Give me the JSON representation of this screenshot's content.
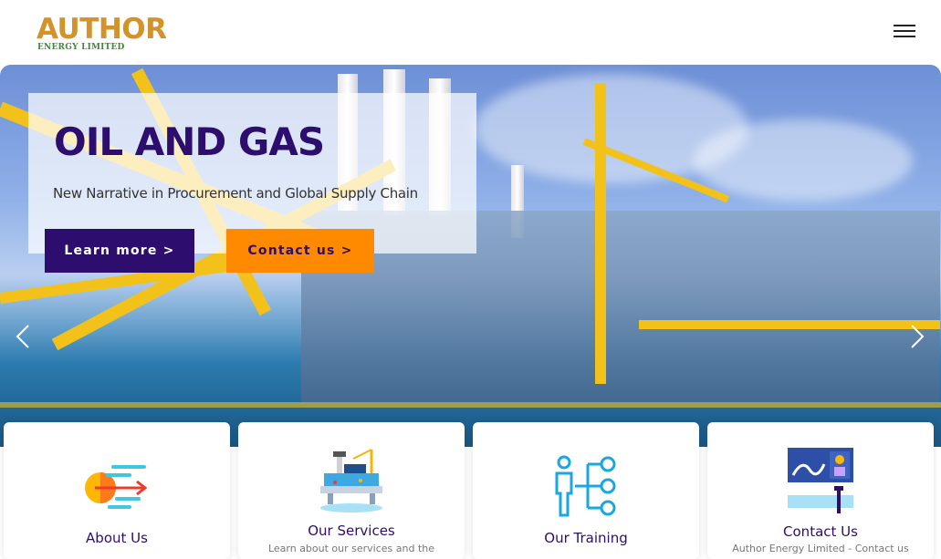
{
  "header": {
    "logo_text": "AUTHOR",
    "logo_subtext": "ENERGY LIMITED",
    "menu_icon": "hamburger-menu-icon"
  },
  "hero": {
    "title": "OIL AND GAS",
    "subtitle": "New Narrative in Procurement and Global Supply Chain",
    "learn_more_label": "Learn more >",
    "contact_label": "Contact us >",
    "prev_icon": "chevron-left-icon",
    "next_icon": "chevron-right-icon"
  },
  "cards": [
    {
      "title": "About Us",
      "description": "",
      "icon": "arrow-target-icon"
    },
    {
      "title": "Our Services",
      "description": "Learn about our services and the",
      "icon": "oil-platform-icon"
    },
    {
      "title": "Our Training",
      "description": "",
      "icon": "person-network-icon"
    },
    {
      "title": "Contact Us",
      "description": "Author Energy Limited - Contact us",
      "icon": "presentation-board-icon"
    }
  ],
  "colors": {
    "brand_purple": "#2d0d6e",
    "brand_orange": "#ff8a00",
    "logo_gold": "#d4922a",
    "logo_green": "#3d8b37"
  }
}
